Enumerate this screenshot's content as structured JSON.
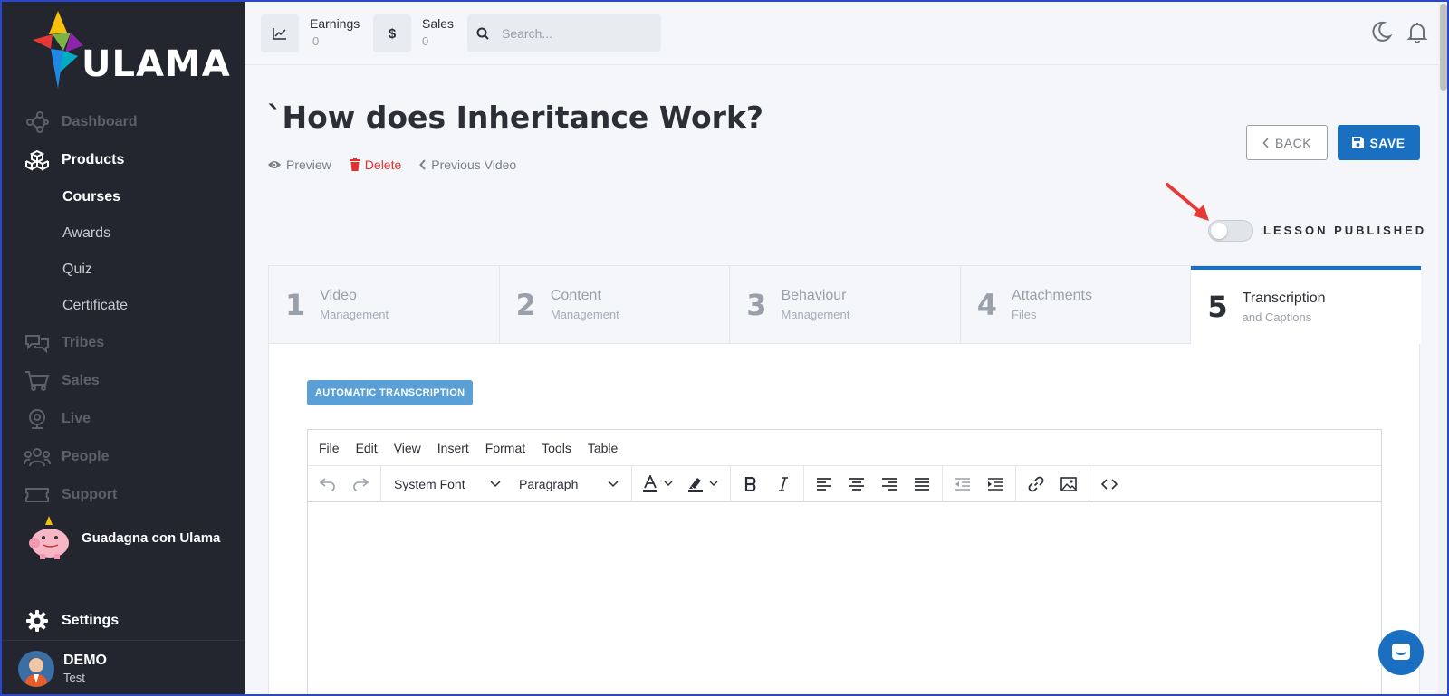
{
  "brand": {
    "name": "ULAMA"
  },
  "sidebar": {
    "items": [
      {
        "label": "Dashboard",
        "icon": "network-icon",
        "active": false
      },
      {
        "label": "Products",
        "icon": "cubes-icon",
        "active": true
      },
      {
        "label": "Tribes",
        "icon": "chat-icon",
        "active": false
      },
      {
        "label": "Sales",
        "icon": "cart-icon",
        "active": false
      },
      {
        "label": "Live",
        "icon": "webcam-icon",
        "active": false
      },
      {
        "label": "People",
        "icon": "people-icon",
        "active": false
      },
      {
        "label": "Support",
        "icon": "ticket-icon",
        "active": false
      }
    ],
    "subitems": [
      {
        "label": "Courses",
        "active": true
      },
      {
        "label": "Awards",
        "active": false
      },
      {
        "label": "Quiz",
        "active": false
      },
      {
        "label": "Certificate",
        "active": false
      }
    ],
    "promo": "Guadagna con Ulama",
    "settings": "Settings",
    "user": {
      "name": "DEMO",
      "role": "Test"
    }
  },
  "topbar": {
    "earnings_label": "Earnings",
    "earnings_value": "0",
    "sales_label": "Sales",
    "sales_value": "0",
    "sales_icon": "$",
    "search_placeholder": "Search..."
  },
  "page": {
    "title": "`How does Inheritance Work?",
    "actions": {
      "preview": "Preview",
      "delete": "Delete",
      "previous": "Previous Video"
    },
    "back_label": "BACK",
    "save_label": "SAVE",
    "published_label": "LESSON PUBLISHED",
    "published": false
  },
  "tabs": [
    {
      "num": "1",
      "title": "Video",
      "sub": "Management",
      "active": false
    },
    {
      "num": "2",
      "title": "Content",
      "sub": "Management",
      "active": false
    },
    {
      "num": "3",
      "title": "Behaviour",
      "sub": "Management",
      "active": false
    },
    {
      "num": "4",
      "title": "Attachments",
      "sub": "Files",
      "active": false
    },
    {
      "num": "5",
      "title": "Transcription",
      "sub": "and Captions",
      "active": true
    }
  ],
  "transcription": {
    "auto_button": "AUTOMATIC TRANSCRIPTION",
    "menu": [
      "File",
      "Edit",
      "View",
      "Insert",
      "Format",
      "Tools",
      "Table"
    ],
    "font_select": "System Font",
    "block_select": "Paragraph"
  },
  "colors": {
    "sidebar_bg": "#23262e",
    "primary": "#1a6fc1",
    "danger": "#e0312f",
    "annotation_arrow": "#e53935"
  }
}
